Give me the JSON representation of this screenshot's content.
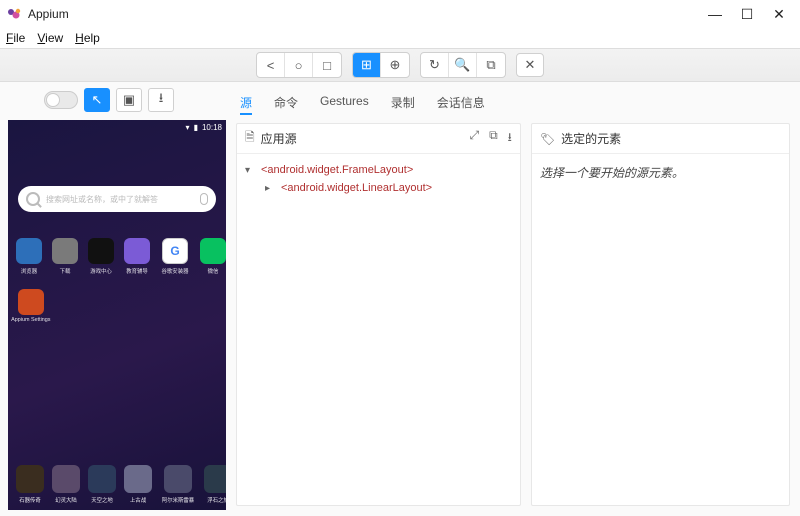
{
  "window": {
    "title": "Appium"
  },
  "menubar": {
    "file": "File",
    "view": "View",
    "help": "Help"
  },
  "toolbar": {
    "back_icon": "<",
    "circle_icon": "○",
    "square_icon": "□",
    "grid_icon": "⊞",
    "globe_icon": "⊕",
    "refresh_icon": "↻",
    "search_icon": "🔍",
    "camera_icon": "⧉",
    "close_icon": "✕"
  },
  "left_controls": {
    "pointer_icon": "↖",
    "box_icon": "▣",
    "download_icon": "⭳"
  },
  "device": {
    "status_time": "10:18",
    "search_placeholder": "搜索网址或名称，或中了就解答",
    "row1": [
      {
        "label": "浏览器",
        "color": "#2d6fb9"
      },
      {
        "label": "下载",
        "color": "#7a7a7a"
      },
      {
        "label": "游戏中心",
        "color": "#111"
      },
      {
        "label": "教育辅导",
        "color": "#7b5bd6"
      },
      {
        "label": "谷歌安装器",
        "color": "#fff"
      },
      {
        "label": "微信",
        "color": "#08c160"
      }
    ],
    "row2": [
      {
        "label": "Appium Settings",
        "color": "#ce4a1f"
      }
    ],
    "dock": [
      {
        "label": "石器传奇",
        "color": "#3a2d1f"
      },
      {
        "label": "幻灵大陆",
        "color": "#5a4a6a"
      },
      {
        "label": "天空之地",
        "color": "#2b3a5a"
      },
      {
        "label": "上古战",
        "color": "#6a6a8a"
      },
      {
        "label": "阿尔米斯雷暴",
        "color": "#4a4a6a"
      },
      {
        "label": "浮石之旅",
        "color": "#2a3a4a"
      }
    ]
  },
  "tabs": {
    "source": "源",
    "cmd": "命令",
    "gestures": "Gestures",
    "record": "录制",
    "session": "会话信息"
  },
  "panes": {
    "source": {
      "title": "应用源",
      "tools": {
        "expand": "⤢",
        "copy": "⧉",
        "download": "⭳"
      },
      "tree": {
        "root": "<android.widget.FrameLayout>",
        "child": "<android.widget.LinearLayout>"
      }
    },
    "selected": {
      "title": "选定的元素",
      "placeholder": "选择一个要开始的源元素。"
    }
  }
}
